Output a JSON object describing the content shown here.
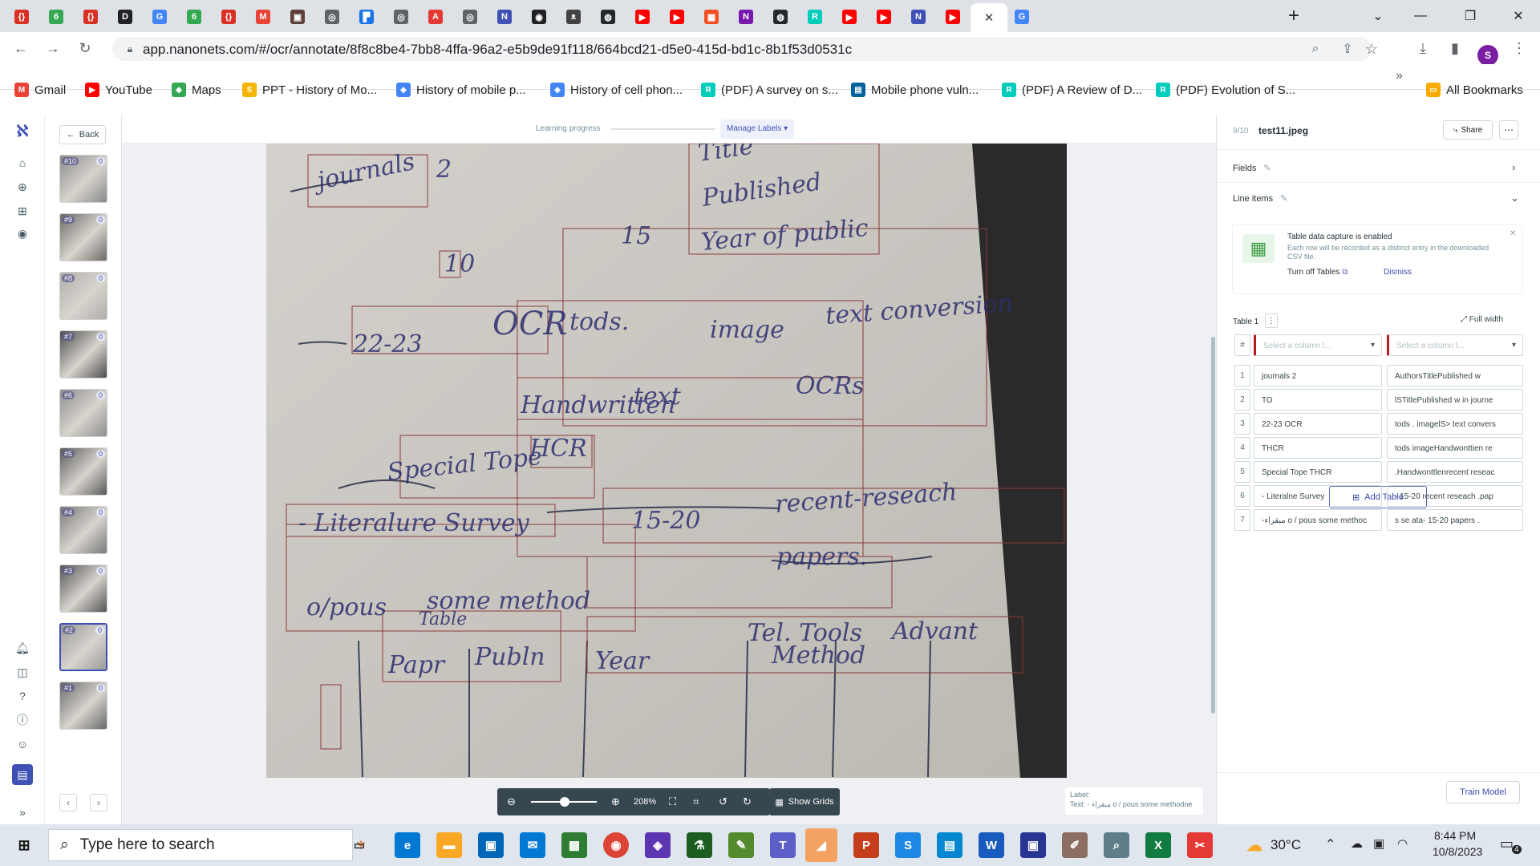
{
  "browser": {
    "tabs": [
      {
        "icon": "generic-red-icon",
        "color": "#d93025",
        "glyph": "{}"
      },
      {
        "icon": "green-s-icon",
        "color": "#34a853",
        "glyph": "6"
      },
      {
        "icon": "generic-red-icon",
        "color": "#d93025",
        "glyph": "{}"
      },
      {
        "icon": "d-icon",
        "color": "#202124",
        "glyph": "D"
      },
      {
        "icon": "google-icon",
        "color": "#4285f4",
        "glyph": "G"
      },
      {
        "icon": "green-s-icon",
        "color": "#34a853",
        "glyph": "6"
      },
      {
        "icon": "generic-red-icon",
        "color": "#d93025",
        "glyph": "{}"
      },
      {
        "icon": "gmail-icon",
        "color": "#ea4335",
        "glyph": "M"
      },
      {
        "icon": "book-icon",
        "color": "#5d4037",
        "glyph": "▣"
      },
      {
        "icon": "globe-icon",
        "color": "#5f6368",
        "glyph": "◎"
      },
      {
        "icon": "chart-icon",
        "color": "#1a73e8",
        "glyph": "▛"
      },
      {
        "icon": "globe-icon",
        "color": "#5f6368",
        "glyph": "◎"
      },
      {
        "icon": "adobe-icon",
        "color": "#e53935",
        "glyph": "A"
      },
      {
        "icon": "globe-icon",
        "color": "#5f6368",
        "glyph": "◎"
      },
      {
        "icon": "nanonets-icon",
        "color": "#3f51b5",
        "glyph": "N"
      },
      {
        "icon": "globe-icon",
        "color": "#202124",
        "glyph": "◉"
      },
      {
        "icon": "cat-icon",
        "color": "#424242",
        "glyph": "ᴥ"
      },
      {
        "icon": "github-icon",
        "color": "#24292e",
        "glyph": "◍"
      },
      {
        "icon": "youtube-icon",
        "color": "#ff0000",
        "glyph": "▶"
      },
      {
        "icon": "youtube-icon",
        "color": "#ff0000",
        "glyph": "▶"
      },
      {
        "icon": "microsoft-icon",
        "color": "#f25022",
        "glyph": "▦"
      },
      {
        "icon": "onenote-icon",
        "color": "#7719aa",
        "glyph": "N"
      },
      {
        "icon": "github-icon",
        "color": "#24292e",
        "glyph": "◍"
      },
      {
        "icon": "researchgate-icon",
        "color": "#00ccbb",
        "glyph": "R"
      },
      {
        "icon": "youtube-icon",
        "color": "#ff0000",
        "glyph": "▶"
      },
      {
        "icon": "youtube-icon",
        "color": "#ff0000",
        "glyph": "▶"
      },
      {
        "icon": "nanonets-icon",
        "color": "#3f51b5",
        "glyph": "N"
      },
      {
        "icon": "youtube-icon",
        "color": "#ff0000",
        "glyph": "▶"
      },
      {
        "icon": "active-tab",
        "color": "#ffffff",
        "glyph": ""
      },
      {
        "icon": "google-icon",
        "color": "#4285f4",
        "glyph": "G"
      }
    ],
    "url": "app.nanonets.com/#/ocr/annotate/8f8c8be4-7bb8-4ffa-96a2-e5b9de91f118/664bcd21-d5e0-415d-bd1c-8b1f53d0531c",
    "profile_initial": "S",
    "bookmarks": [
      {
        "label": "Gmail",
        "icon": "gmail-icon",
        "color": "#ea4335",
        "glyph": "M"
      },
      {
        "label": "YouTube",
        "icon": "youtube-icon",
        "color": "#ff0000",
        "glyph": "▶"
      },
      {
        "label": "Maps",
        "icon": "maps-icon",
        "color": "#34a853",
        "glyph": "◆"
      },
      {
        "label": "PPT - History of Mo...",
        "icon": "slides-icon",
        "color": "#f4b400",
        "glyph": "S"
      },
      {
        "label": "History of mobile p...",
        "icon": "scholar-icon",
        "color": "#4285f4",
        "glyph": "◈"
      },
      {
        "label": "History of cell phon...",
        "icon": "scholar-icon",
        "color": "#4285f4",
        "glyph": "◈"
      },
      {
        "label": "(PDF) A survey on s...",
        "icon": "researchgate-icon",
        "color": "#00ccbb",
        "glyph": "R"
      },
      {
        "label": "Mobile phone vuln...",
        "icon": "ieee-icon",
        "color": "#00629b",
        "glyph": "▤"
      },
      {
        "label": "(PDF) A Review of D...",
        "icon": "researchgate-icon",
        "color": "#00ccbb",
        "glyph": "R"
      },
      {
        "label": "(PDF) Evolution of S...",
        "icon": "researchgate-icon",
        "color": "#00ccbb",
        "glyph": "R"
      }
    ],
    "bookmarks_overflow": "»",
    "all_bookmarks": "All Bookmarks"
  },
  "app": {
    "back_label": "Back",
    "learning_progress": "Learning progress",
    "manage_labels": "Manage Labels",
    "file_counter": "9/10",
    "file_name": "test11.jpeg",
    "share_label": "Share",
    "fields_label": "Fields",
    "line_items_label": "Line items",
    "notice_title": "Table data capture is enabled",
    "notice_body": "Each row will be recorded as a distinct entry in the downloaded CSV file.",
    "turn_off_tables": "Turn off Tables",
    "dismiss": "Dismiss",
    "table_title": "Table 1",
    "full_width": "Full width",
    "col_placeholder": "Select a column l...",
    "hash": "#",
    "add_table": "Add Table",
    "train_model": "Train Model",
    "zoom": "208%",
    "show_grids": "Show Grids",
    "label_caption": "Label:",
    "label_text": "Text: - مبقراء o / pous some methodne",
    "rows": [
      {
        "n": "1",
        "a": "journals 2",
        "b": "AuthorsTitlePublished w"
      },
      {
        "n": "2",
        "a": "TO",
        "b": "lSTitlePublished w in journe"
      },
      {
        "n": "3",
        "a": "22-23 OCR",
        "b": "tods . imagelS> text convers"
      },
      {
        "n": "4",
        "a": "THCR",
        "b": "tods imageHandwonttien re"
      },
      {
        "n": "5",
        "a": "Special Tope THCR",
        "b": ".Handwonttlenrecent reseac"
      },
      {
        "n": "6",
        "a": "- Literalne Survey",
        "b": "- 15-20 recent reseach .pap"
      },
      {
        "n": "7",
        "a": "-مبقراء o / pous some methoc",
        "b": "s se ata- 15-20 papers ."
      }
    ],
    "thumbnails": [
      {
        "n": "#10",
        "c": "0"
      },
      {
        "n": "#9",
        "c": "0"
      },
      {
        "n": "#8",
        "c": "0"
      },
      {
        "n": "#7",
        "c": "0"
      },
      {
        "n": "#6",
        "c": "0"
      },
      {
        "n": "#5",
        "c": "0"
      },
      {
        "n": "#4",
        "c": "0"
      },
      {
        "n": "#3",
        "c": "0"
      },
      {
        "n": "#2",
        "c": "0"
      },
      {
        "n": "#1",
        "c": "0"
      }
    ]
  },
  "taskbar": {
    "search_placeholder": "Type here to search",
    "temperature": "30°C",
    "time": "8:44 PM",
    "date": "10/8/2023",
    "notifications": "4"
  }
}
